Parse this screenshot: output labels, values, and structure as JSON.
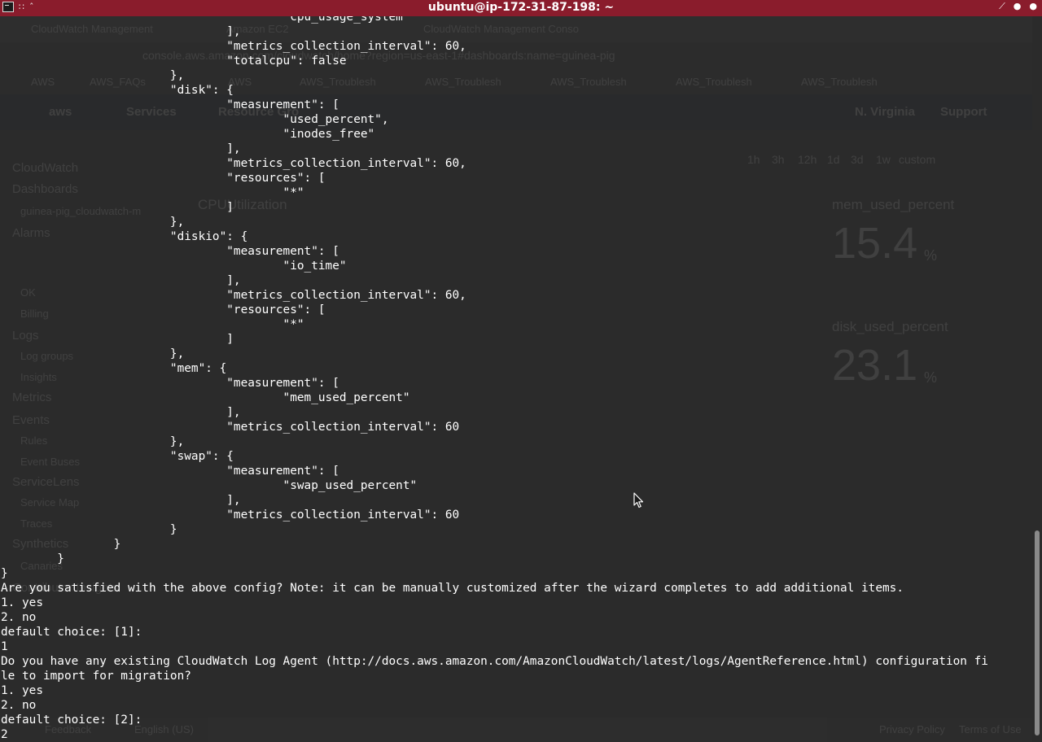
{
  "window": {
    "title": "ubuntu@ip-172-31-87-198: ~"
  },
  "background_browser": {
    "tabs": [
      "CloudWatch Management",
      "Amazon EC2",
      "CloudWatch Management Conso"
    ],
    "url": "console.aws.amazon.com/cloudwatch/home?region=us-east-1#dashboards:name=guinea-pig",
    "bookmarks": [
      "AWS",
      "AWS_FAQs",
      "AWS",
      "AWS_Troublesh",
      "AWS_Troublesh",
      "AWS_Troublesh",
      "AWS_Troublesh",
      "AWS_Troublesh"
    ],
    "aws_nav": [
      "aws",
      "Services",
      "Resource Gro",
      "N. Virginia",
      "Support"
    ],
    "sidebar": [
      "CloudWatch",
      "Dashboards",
      "guinea-pig_cloudwatch-m",
      "Alarms",
      "OK",
      "Billing",
      "Logs",
      "Log groups",
      "Insights",
      "Metrics",
      "Events",
      "Rules",
      "Event Buses",
      "ServiceLens",
      "Service Map",
      "Traces",
      "Synthetics",
      "Canaries",
      "Contributor Insights"
    ],
    "time_ranges": [
      "1h",
      "3h",
      "12h",
      "1d",
      "3d",
      "1w",
      "custom"
    ],
    "widgets": [
      {
        "title": "CPUUtilization"
      },
      {
        "title": "mem_used_percent",
        "value": "15.4",
        "unit": "%"
      },
      {
        "title": "disk_used_percent",
        "value": "23.1",
        "unit": "%"
      }
    ],
    "footer": [
      "Feedback",
      "English (US)",
      "Privacy Policy",
      "Terms of Use"
    ]
  },
  "terminal": {
    "lines": [
      "                                        \"cpu_usage_system\"",
      "                                ],",
      "                                \"metrics_collection_interval\": 60,",
      "                                \"totalcpu\": false",
      "                        },",
      "                        \"disk\": {",
      "                                \"measurement\": [",
      "                                        \"used_percent\",",
      "                                        \"inodes_free\"",
      "                                ],",
      "                                \"metrics_collection_interval\": 60,",
      "                                \"resources\": [",
      "                                        \"*\"",
      "                                ]",
      "                        },",
      "                        \"diskio\": {",
      "                                \"measurement\": [",
      "                                        \"io_time\"",
      "                                ],",
      "                                \"metrics_collection_interval\": 60,",
      "                                \"resources\": [",
      "                                        \"*\"",
      "                                ]",
      "                        },",
      "                        \"mem\": {",
      "                                \"measurement\": [",
      "                                        \"mem_used_percent\"",
      "                                ],",
      "                                \"metrics_collection_interval\": 60",
      "                        },",
      "                        \"swap\": {",
      "                                \"measurement\": [",
      "                                        \"swap_used_percent\"",
      "                                ],",
      "                                \"metrics_collection_interval\": 60",
      "                        }",
      "                }",
      "        }",
      "}",
      "Are you satisfied with the above config? Note: it can be manually customized after the wizard completes to add additional items.",
      "1. yes",
      "2. no",
      "default choice: [1]:",
      "1",
      "Do you have any existing CloudWatch Log Agent (http://docs.aws.amazon.com/AmazonCloudWatch/latest/logs/AgentReference.html) configuration fi",
      "le to import for migration?",
      "1. yes",
      "2. no",
      "default choice: [2]:",
      "2"
    ]
  },
  "icons": {
    "terminal": "terminal-icon",
    "minimize": "minimize-icon",
    "maximize": "maximize-icon",
    "close": "close-icon",
    "cursor": "mouse-pointer-icon"
  },
  "colors": {
    "titlebar": "#8a1c2c",
    "terminal_bg": "#2b2b2b",
    "text": "#ffffff"
  }
}
